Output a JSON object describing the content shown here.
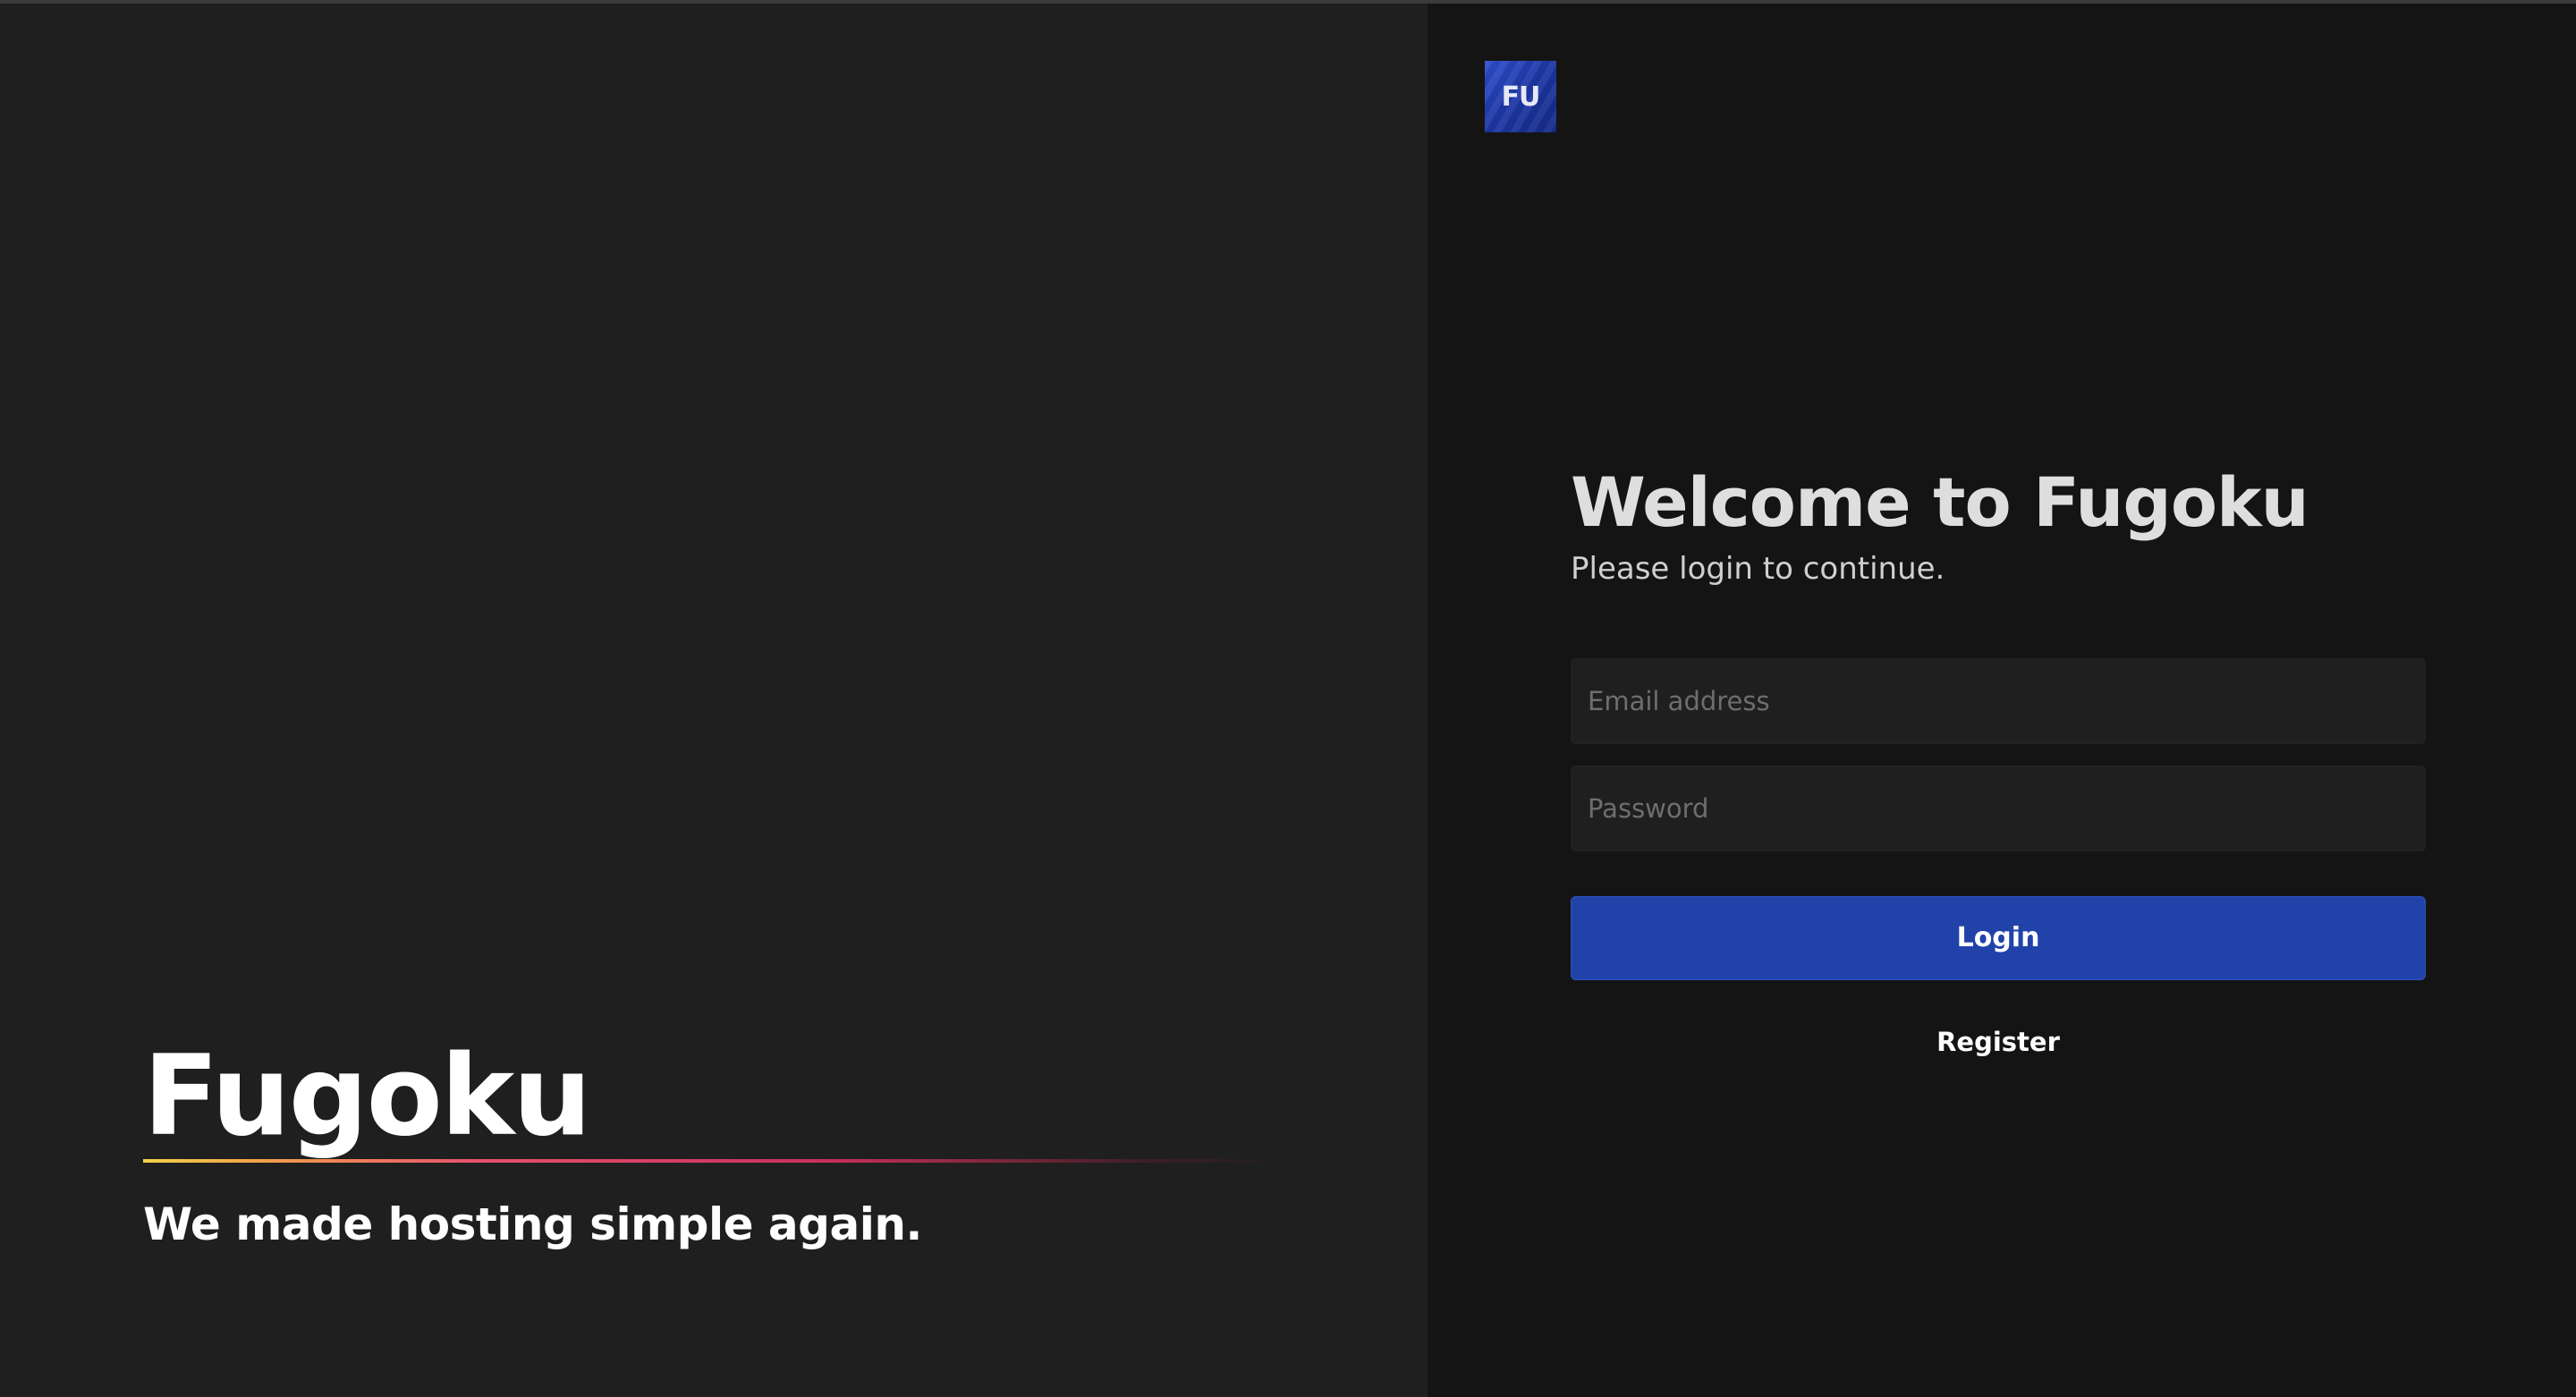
{
  "brand": {
    "name": "Fugoku",
    "tagline": "We made hosting simple again.",
    "logo_text": "FU",
    "underline_colors": [
      "#f2d14a",
      "#e5506f",
      "#c9305a"
    ]
  },
  "login": {
    "title": "Welcome to Fugoku",
    "subtitle": "Please login to continue.",
    "email_placeholder": "Email address",
    "email_value": "",
    "password_placeholder": "Password",
    "password_value": "",
    "login_label": "Login",
    "register_label": "Register"
  },
  "colors": {
    "left_background": "#1f1f1f",
    "right_background": "#141414",
    "accent_button": "#2143a9",
    "logo_blue": "#1d36a3"
  }
}
